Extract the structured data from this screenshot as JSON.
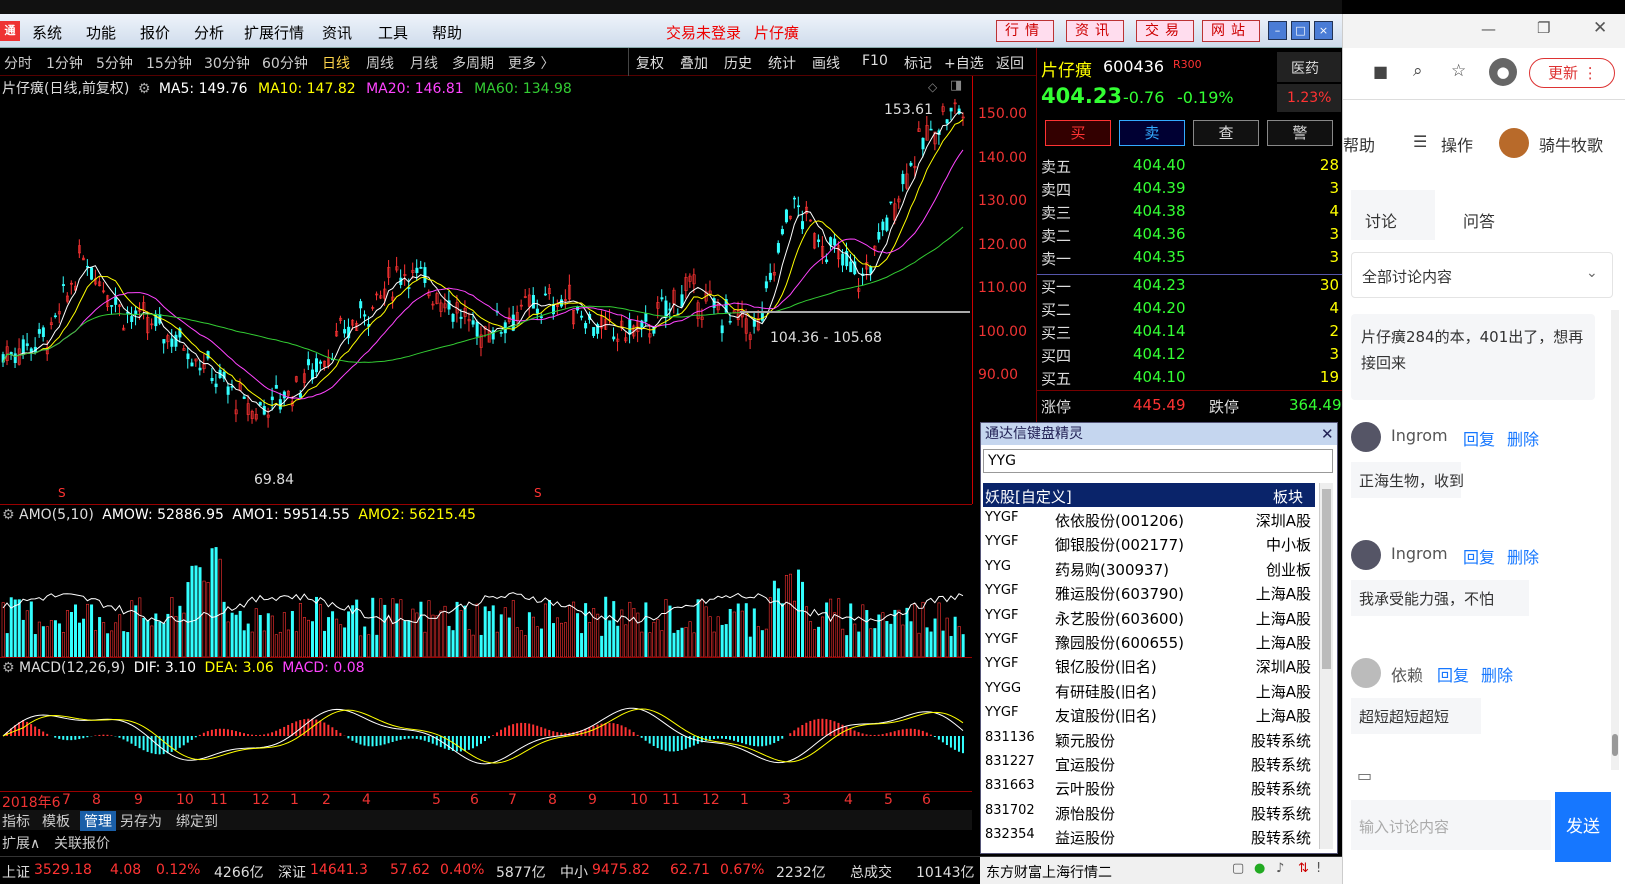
{
  "menu": {
    "items": [
      "系统",
      "功能",
      "报价",
      "分析",
      "扩展行情",
      "资讯",
      "工具",
      "帮助"
    ],
    "warn1": "交易未登录",
    "warn2": "片仔癀",
    "buttons": [
      "行情",
      "资讯",
      "交易",
      "网站"
    ]
  },
  "periods": [
    "分时",
    "1分钟",
    "5分钟",
    "15分钟",
    "30分钟",
    "60分钟",
    "日线",
    "周线",
    "月线",
    "多周期",
    "更多 〉"
  ],
  "tools": [
    "复权",
    "叠加",
    "历史",
    "统计",
    "画线",
    "F10",
    "标记",
    "+自选",
    "返回"
  ],
  "chart": {
    "title": "片仔癀(日线,前复权)",
    "ma5": "MA5: 149.76",
    "ma10": "MA10: 147.82",
    "ma20": "MA20: 146.81",
    "ma60": "MA60: 134.98",
    "hi": "153.61",
    "lo": "69.84",
    "range": "104.36 - 105.68",
    "marker": "S",
    "yticks": [
      "150.00",
      "140.00",
      "130.00",
      "120.00",
      "110.00",
      "100.00",
      "90.00"
    ]
  },
  "amo": {
    "label": "AMO(5,10)",
    "amow": "AMOW: 52886.95",
    "amo1": "AMO1: 59514.55",
    "amo2": "AMO2: 56215.45"
  },
  "macd": {
    "label": "MACD(12,26,9)",
    "dif": "DIF: 3.10",
    "dea": "DEA: 3.06",
    "macd": "MACD: 0.08"
  },
  "xaxis": [
    "2018年6",
    "7",
    "8",
    "9",
    "10",
    "11",
    "12",
    "1",
    "2",
    "4",
    "5",
    "6",
    "7",
    "8",
    "9",
    "10",
    "11",
    "12",
    "1",
    "3",
    "4",
    "5",
    "6"
  ],
  "bottomtabs": [
    "指标",
    "模板",
    "管理",
    "另存为",
    "绑定到"
  ],
  "bottomtabs2": [
    "扩展∧",
    "关联报价"
  ],
  "quote": {
    "name": "片仔癀",
    "code": "600436",
    "tag": "R300",
    "sector": "医药",
    "price": "404.23",
    "change": "-0.76",
    "pct": "-0.19%",
    "turnover": "1.23%",
    "actions": [
      "买",
      "卖",
      "查",
      "警"
    ],
    "sells": [
      [
        "卖五",
        "404.40",
        "28"
      ],
      [
        "卖四",
        "404.39",
        "3"
      ],
      [
        "卖三",
        "404.38",
        "4"
      ],
      [
        "卖二",
        "404.36",
        "3"
      ],
      [
        "卖一",
        "404.35",
        "3"
      ]
    ],
    "buys": [
      [
        "买一",
        "404.23",
        "30"
      ],
      [
        "买二",
        "404.20",
        "4"
      ],
      [
        "买三",
        "404.14",
        "2"
      ],
      [
        "买四",
        "404.12",
        "3"
      ],
      [
        "买五",
        "404.10",
        "19"
      ]
    ],
    "limitup_label": "涨停",
    "limitup": "445.49",
    "limitdown_label": "跌停",
    "limitdown": "364.49"
  },
  "spirit": {
    "title": "通达信键盘精灵",
    "input": "YYG",
    "header_name": "妖股[自定义]",
    "header_type": "板块",
    "rows": [
      [
        "YYGF",
        "依依股份(001206)",
        "深圳A股"
      ],
      [
        "YYGF",
        "御银股份(002177)",
        "中小板"
      ],
      [
        "YYG",
        "药易购(300937)",
        "创业板"
      ],
      [
        "YYGF",
        "雅运股份(603790)",
        "上海A股"
      ],
      [
        "YYGF",
        "永艺股份(603600)",
        "上海A股"
      ],
      [
        "YYGF",
        "豫园股份(600655)",
        "上海A股"
      ],
      [
        "YYGF",
        "银亿股份(旧名)",
        "深圳A股"
      ],
      [
        "YYGG",
        "有研硅股(旧名)",
        "上海A股"
      ],
      [
        "YYGF",
        "友谊股份(旧名)",
        "上海A股"
      ],
      [
        "831136",
        "颖元股份",
        "股转系统"
      ],
      [
        "831227",
        "宜运股份",
        "股转系统"
      ],
      [
        "831663",
        "云叶股份",
        "股转系统"
      ],
      [
        "831702",
        "源怡股份",
        "股转系统"
      ],
      [
        "832354",
        "益运股份",
        "股转系统"
      ]
    ]
  },
  "status": {
    "sh_label": "上证",
    "sh": "3529.18",
    "sh_chg": "4.08",
    "sh_pct": "0.12%",
    "sh_vol": "4266亿",
    "sz_label": "深证",
    "sz": "14641.3",
    "sz_chg": "57.62",
    "sz_pct": "0.40%",
    "sz_vol": "5877亿",
    "zx_label": "中小",
    "zx": "9475.82",
    "zx_chg": "62.71",
    "zx_pct": "0.67%",
    "zx_vol": "2232亿",
    "total_label": "总成交",
    "total": "10143亿",
    "server": "东方财富上海行情二"
  },
  "browser": {
    "update": "更新",
    "help": "帮助",
    "ops": "操作",
    "user": "骑牛牧歌",
    "tabs": [
      "讨论",
      "问答"
    ],
    "filter": "全部讨论内容",
    "post": "片仔癀284的本，401出了，想再接回来",
    "comments": [
      {
        "user": "Ingrom",
        "reply": "回复",
        "del": "删除",
        "text": "正海生物，收到"
      },
      {
        "user": "Ingrom",
        "reply": "回复",
        "del": "删除",
        "text": "我承受能力强，不怕"
      },
      {
        "user": "依赖",
        "reply": "回复",
        "del": "删除",
        "text": "超短超短超短"
      }
    ],
    "placeholder": "输入讨论内容",
    "send": "发送"
  },
  "colors": {
    "up": "#ff3333",
    "down": "#33ffff",
    "ma5": "#ffffff",
    "ma10": "#ffff00",
    "ma20": "#ff44ff",
    "ma60": "#33cc33"
  }
}
